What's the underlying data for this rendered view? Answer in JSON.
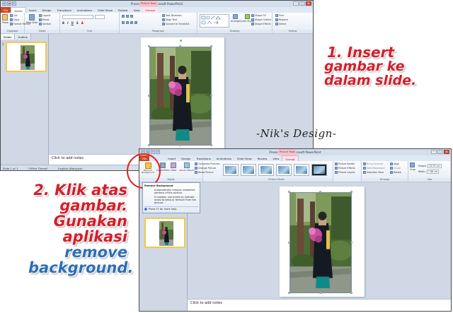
{
  "top_window": {
    "title": "Presentation1 - Microsoft PowerPoint",
    "context_tab": "Picture Tools",
    "tabs": [
      "File",
      "Home",
      "Insert",
      "Design",
      "Transitions",
      "Animations",
      "Slide Show",
      "Review",
      "View",
      "Format"
    ],
    "ribbon": {
      "paste": "Paste",
      "cut": "Cut",
      "copy": "Copy",
      "format_painter": "Format Painter",
      "clipboard": "Clipboard",
      "new_slide": "New Slide",
      "layout": "Layout",
      "reset": "Reset",
      "section": "Section",
      "slides": "Slides",
      "font": "Font",
      "text_direction": "Text Direction",
      "align_text": "Align Text",
      "convert_smartart": "Convert to SmartArt",
      "paragraph": "Paragraph",
      "arrange": "Arrange",
      "quick_styles": "Quick Styles",
      "shape_fill": "Shape Fill",
      "shape_outline": "Shape Outline",
      "shape_effects": "Shape Effects",
      "drawing": "Drawing",
      "find": "Find",
      "replace": "Replace",
      "select": "Select",
      "editing": "Editing"
    },
    "pane_tabs": [
      "Slides",
      "Outline"
    ],
    "notes": "Click to add notes",
    "status": [
      "Slide 1 of 1",
      "\"Office Theme\"",
      "English (Malaysia)"
    ]
  },
  "bottom_window": {
    "title": "Presentation1 - Microsoft PowerPoint",
    "context_tab": "Picture Tools",
    "tabs": [
      "File",
      "Insert",
      "Design",
      "Transitions",
      "Animations",
      "Slide Show",
      "Review",
      "View",
      "Format"
    ],
    "ribbon": {
      "remove_background": "Remove Background",
      "corrections": "Corrections",
      "color": "Color",
      "artistic_effects": "Artistic Effects",
      "compress": "Compress Pictures",
      "change": "Change Picture",
      "reset": "Reset Picture",
      "adjust": "Adjust",
      "picture_styles": "Picture Styles",
      "picture_border": "Picture Border",
      "picture_effects": "Picture Effects",
      "picture_layout": "Picture Layout",
      "bring_forward": "Bring Forward",
      "send_backward": "Send Backward",
      "selection_pane": "Selection Pane",
      "align": "Align",
      "group": "Group",
      "rotate": "Rotate",
      "arrange": "Arrange",
      "crop": "Crop",
      "height_label": "Height:",
      "height_value": "13.53 cm",
      "width_label": "Width:",
      "width_value": "7.86 cm",
      "size": "Size"
    },
    "tooltip": {
      "title": "Remove Background",
      "line1": "Automatically remove unwanted portions of the picture.",
      "line2": "If needed, use marks to indicate areas to keep or remove from the picture.",
      "help": "Press F1 for more help."
    },
    "notes": "Click to add notes"
  },
  "annotations": {
    "step1": [
      "1. Insert",
      "gambar ke",
      "dalam slide."
    ],
    "step2": [
      "2. Klik atas",
      "gambar.",
      "Gunakan",
      "aplikasi",
      "remove",
      "background."
    ],
    "brand": "-Nik's Design-"
  },
  "colors": {
    "annotation_red": "#d21f2a",
    "annotation_blue": "#2d6fb3",
    "highlight_circle": "#e02020",
    "file_tab": "#d2471f",
    "picture_tools_tab": "#f5c2d0"
  }
}
